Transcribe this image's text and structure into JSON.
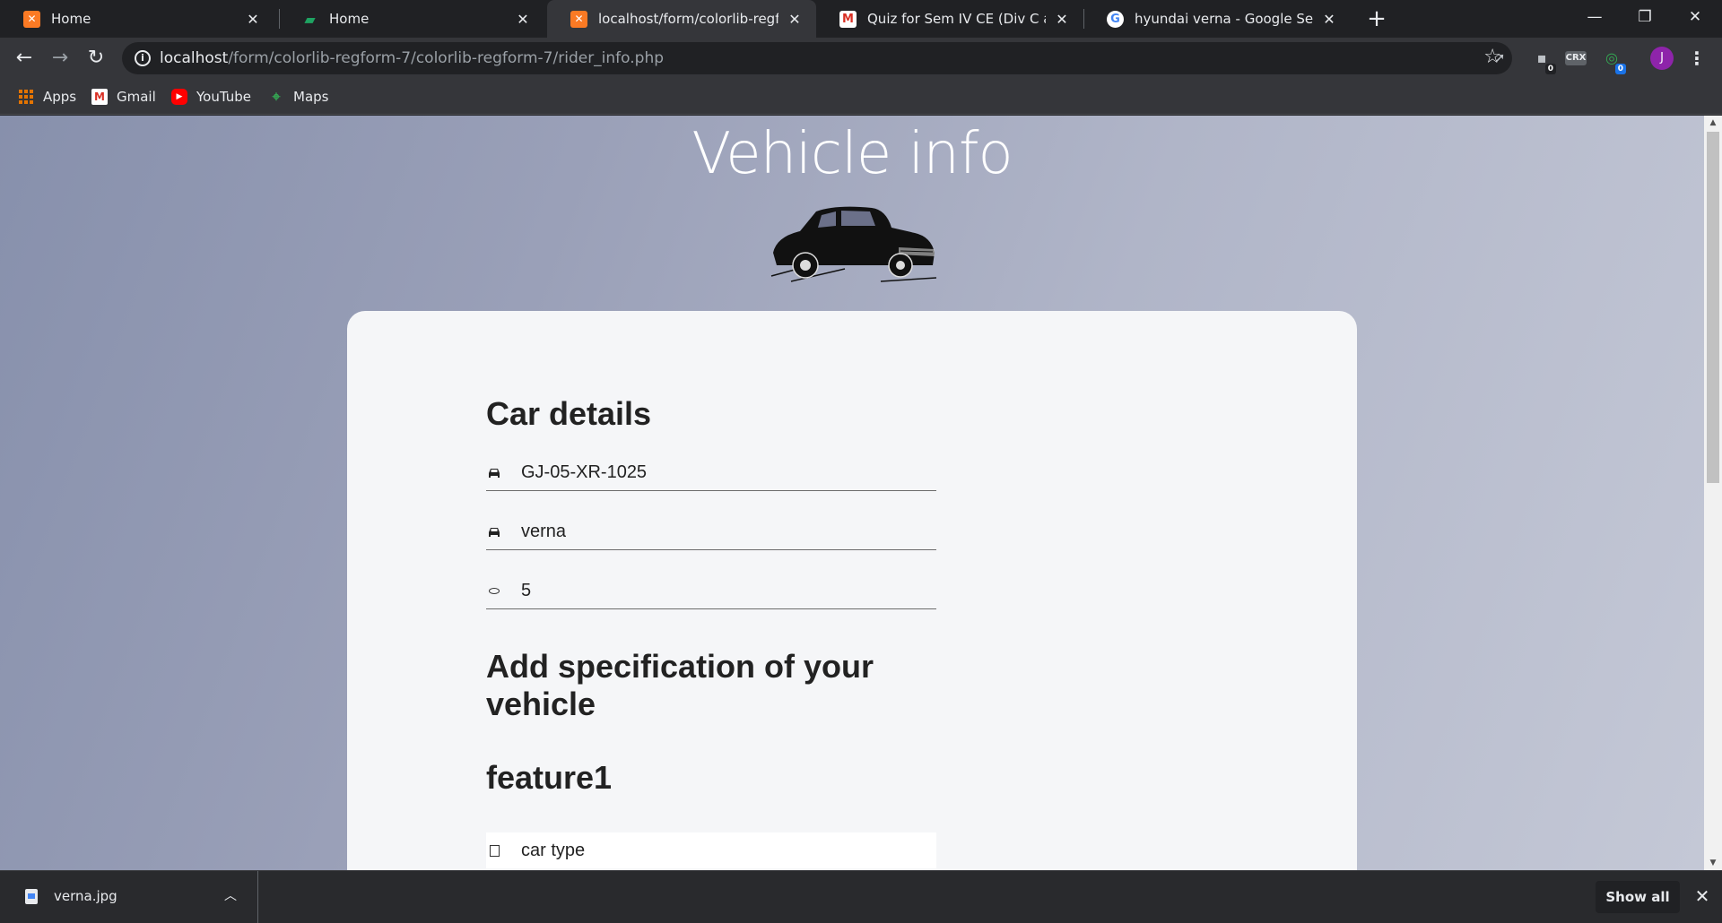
{
  "browser": {
    "tabs": [
      {
        "title": "Home",
        "favicon": "xampp-icon",
        "active": false
      },
      {
        "title": "Home",
        "favicon": "chat-icon",
        "active": false
      },
      {
        "title": "localhost/form/colorlib-regform-",
        "favicon": "xampp-icon",
        "active": true
      },
      {
        "title": "Quiz for Sem IV CE (Div C and D)",
        "favicon": "gmail-icon",
        "active": false
      },
      {
        "title": "hyundai verna - Google Search",
        "favicon": "google-icon",
        "active": false
      }
    ],
    "address": {
      "host": "localhost",
      "path": "/form/colorlib-regform-7/colorlib-regform-7/rider_info.php"
    },
    "extensions": {
      "ext1_badge": "0",
      "crx_label": "CRX",
      "ext3_badge": "0"
    },
    "profile_initial": "J",
    "bookmarks": [
      {
        "label": "Apps",
        "icon": "apps-grid-icon"
      },
      {
        "label": "Gmail",
        "icon": "gmail-icon"
      },
      {
        "label": "YouTube",
        "icon": "youtube-icon"
      },
      {
        "label": "Maps",
        "icon": "maps-icon"
      }
    ]
  },
  "page": {
    "title": "Vehicle info",
    "car_details_heading": "Car details",
    "fields": [
      {
        "value": "GJ-05-XR-1025",
        "icon": "car-icon"
      },
      {
        "value": "verna",
        "icon": "car-icon"
      },
      {
        "value": "5",
        "icon": "seat-icon"
      }
    ],
    "spec_heading_line1": "Add specification of your",
    "spec_heading_line2": "vehicle",
    "feature_heading": "feature1",
    "feature_field": {
      "value": "car type",
      "icon": "checkbox-icon"
    }
  },
  "downloads": {
    "file_name": "verna.jpg",
    "show_all_label": "Show all"
  },
  "colors": {
    "brand_bg_start": "#8790ac",
    "brand_bg_end": "#c4c8d6",
    "card": "#f5f6f8",
    "avatar": "#8e24aa"
  }
}
